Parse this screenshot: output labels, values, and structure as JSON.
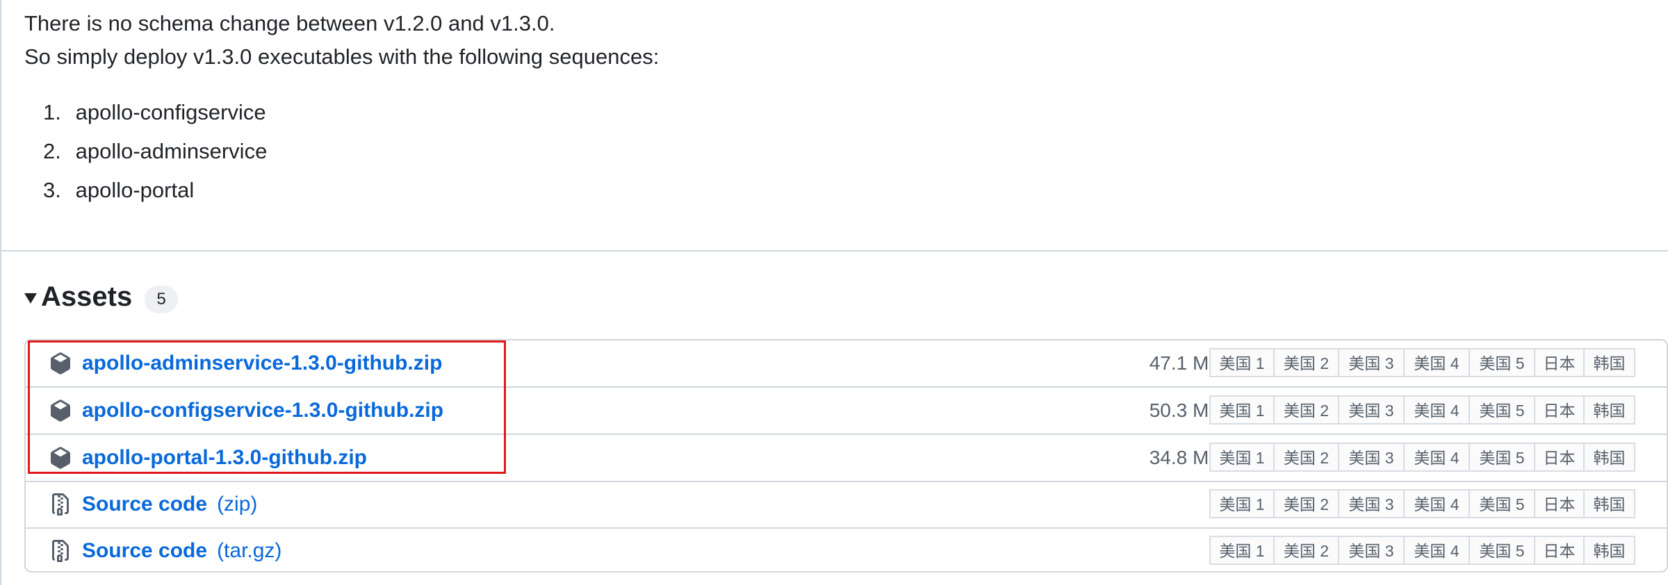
{
  "notes": {
    "line1": "There is no schema change between v1.2.0 and v1.3.0.",
    "line2": "So simply deploy v1.3.0 executables with the following sequences:",
    "steps": [
      {
        "num": "1.",
        "text": "apollo-configservice"
      },
      {
        "num": "2.",
        "text": "apollo-adminservice"
      },
      {
        "num": "3.",
        "text": "apollo-portal"
      }
    ]
  },
  "assets": {
    "title": "Assets",
    "count": "5",
    "rows": [
      {
        "icon": "package-icon",
        "name": "apollo-adminservice-1.3.0-github.zip",
        "size": "47.1 MB"
      },
      {
        "icon": "package-icon",
        "name": "apollo-configservice-1.3.0-github.zip",
        "size": "50.3 MB"
      },
      {
        "icon": "package-icon",
        "name": "apollo-portal-1.3.0-github.zip",
        "size": "34.8 MB"
      },
      {
        "icon": "file-zip-icon",
        "name": "Source code",
        "suffix": "(zip)"
      },
      {
        "icon": "file-zip-icon",
        "name": "Source code",
        "suffix": "(tar.gz)"
      }
    ],
    "mirrors": [
      "美国 1",
      "美国 2",
      "美国 3",
      "美国 4",
      "美国 5",
      "日本",
      "韩国"
    ]
  },
  "colors": {
    "link": "#0969da",
    "highlight": "#e0191b",
    "border": "#d0d7de"
  }
}
